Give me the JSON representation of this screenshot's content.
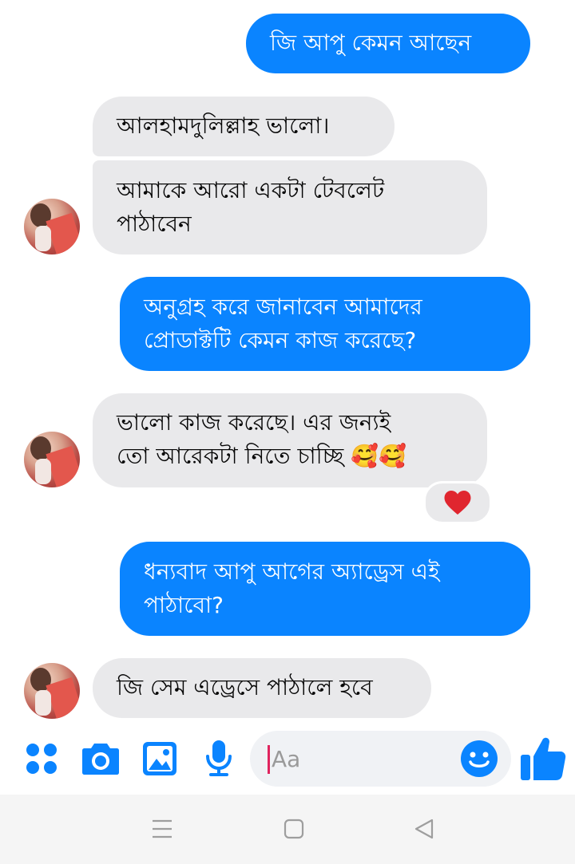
{
  "messages": [
    {
      "text": "জি আপু কেমন আছেন"
    },
    {
      "text": "আলহামদুলিল্লাহ ভালো।"
    },
    {
      "text": "আমাকে আরো একটা টেবলেট\nপাঠাবেন"
    },
    {
      "text": "অনুগ্রহ করে জানাবেন আমাদের\nপ্রোডাক্টটি কেমন কাজ করেছে?"
    },
    {
      "text": " ভালো কাজ করেছে। এর জন্যই\nতো আরেকটা নিতে চাচ্ছি 🥰🥰"
    },
    {
      "text": "ধন্যবাদ আপু আগের অ্যাড্রেস এই\nপাঠাবো?"
    },
    {
      "text": "জি সেম এড্রেসে পাঠালে হবে"
    }
  ],
  "reaction": "heart",
  "composer": {
    "placeholder": "Aa",
    "icons": [
      "menu-dots-icon",
      "camera-icon",
      "gallery-icon",
      "microphone-icon",
      "emoji-icon",
      "thumbs-up-icon"
    ]
  },
  "navbar": {
    "icons": [
      "recent-apps-icon",
      "home-icon",
      "back-icon"
    ]
  },
  "colors": {
    "accent": "#0a84ff",
    "incoming_bubble": "#e9e9eb",
    "heart": "#e0262f"
  }
}
